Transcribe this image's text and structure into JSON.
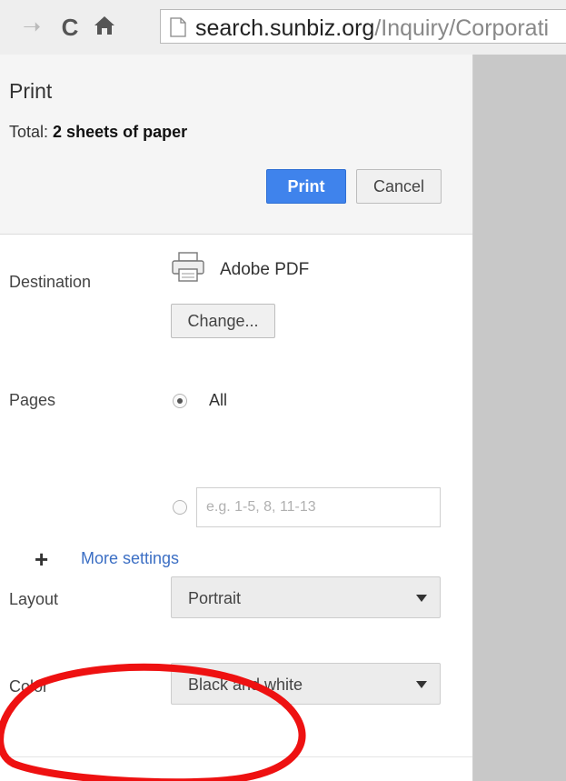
{
  "browser": {
    "url_host": "search.sunbiz.org",
    "url_path": "/Inquiry/Corporati",
    "forward_icon": "forward-arrow-icon",
    "reload_icon": "reload-icon",
    "home_icon": "home-icon",
    "page_icon": "page-icon"
  },
  "print": {
    "title": "Print",
    "total_label": "Total:",
    "total_value": "2 sheets of paper",
    "print_button": "Print",
    "cancel_button": "Cancel"
  },
  "destination": {
    "label": "Destination",
    "printer_name": "Adobe PDF",
    "printer_icon": "printer-icon",
    "change_button": "Change..."
  },
  "pages": {
    "label": "Pages",
    "all_option": "All",
    "all_selected": true,
    "custom_placeholder": "e.g. 1-5, 8, 11-13"
  },
  "layout": {
    "label": "Layout",
    "selected": "Portrait"
  },
  "color": {
    "label": "Color",
    "selected": "Black and white"
  },
  "more_settings": {
    "label": "More settings",
    "icon": "plus-icon"
  },
  "colors": {
    "accent_blue": "#3f83ec",
    "link_blue": "#3c6fc4",
    "annotation_red": "#ee1111"
  }
}
